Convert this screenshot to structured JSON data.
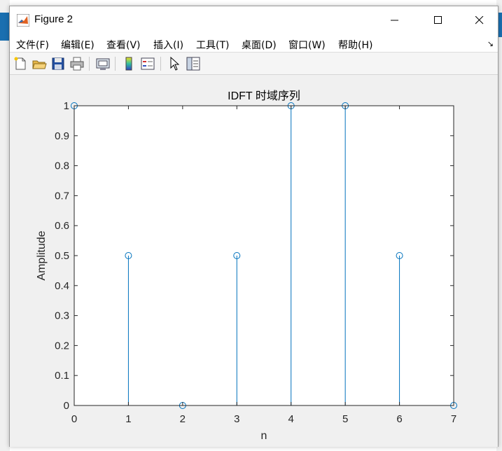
{
  "window": {
    "title": "Figure 2"
  },
  "menu": {
    "items": [
      "文件(F)",
      "编辑(E)",
      "查看(V)",
      "插入(I)",
      "工具(T)",
      "桌面(D)",
      "窗口(W)",
      "帮助(H)"
    ]
  },
  "toolbar": {
    "buttons": [
      "new-figure-icon",
      "open-file-icon",
      "save-icon",
      "print-icon",
      "link-icon",
      "colorbar-icon",
      "legend-icon",
      "edit-plot-arrow-icon",
      "property-inspector-icon"
    ]
  },
  "colors": {
    "series": "#0072bd",
    "axes": "#262626",
    "background": "#ffffff"
  },
  "chart_data": {
    "type": "stem",
    "title": "IDFT 时域序列",
    "xlabel": "n",
    "ylabel": "Amplitude",
    "x": [
      0,
      1,
      2,
      3,
      4,
      5,
      6,
      7
    ],
    "values": [
      1,
      0.5,
      0,
      0.5,
      1,
      1,
      0.5,
      0
    ],
    "xlim": [
      0,
      7
    ],
    "ylim": [
      0,
      1
    ],
    "xticks": [
      "0",
      "1",
      "2",
      "3",
      "4",
      "5",
      "6",
      "7"
    ],
    "yticks": [
      "0",
      "0.1",
      "0.2",
      "0.3",
      "0.4",
      "0.5",
      "0.6",
      "0.7",
      "0.8",
      "0.9",
      "1"
    ],
    "grid": false,
    "marker": "circle"
  }
}
